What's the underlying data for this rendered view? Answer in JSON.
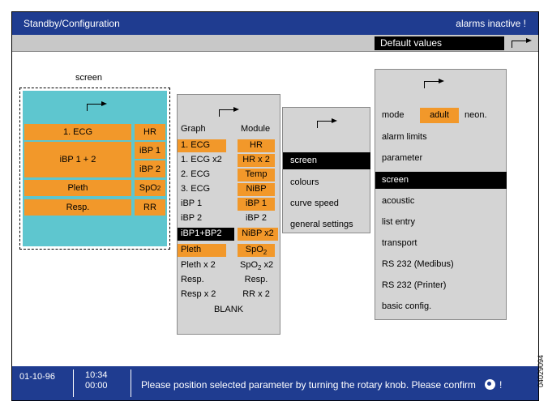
{
  "title": {
    "left": "Standby/Configuration",
    "right": "alarms inactive !"
  },
  "toolbar": {
    "default_values": "Default values",
    "arrow_icon": "return-arrow-icon"
  },
  "preview": {
    "label": "screen",
    "arrow_icon": "return-arrow-icon",
    "cells": {
      "ecg": "1. ECG",
      "hr": "HR",
      "ibp12": "iBP 1 + 2",
      "ibp1": "iBP 1",
      "ibp2": "iBP 2",
      "pleth": "Pleth",
      "spo2": "SpO",
      "spo2_sub": "2",
      "resp": "Resp.",
      "rr": "RR"
    },
    "colors": {
      "background": "#5ec6cf",
      "cell": "#f2982a"
    }
  },
  "module_panel": {
    "headers": {
      "graph": "Graph",
      "module": "Module"
    },
    "graph": [
      "1. ECG",
      "1. ECG x2",
      "2. ECG",
      "3. ECG",
      "iBP 1",
      "iBP 2",
      "iBP1+BP2",
      "Pleth",
      "Pleth x 2",
      "Resp.",
      "Resp x 2"
    ],
    "module": [
      "HR",
      "HR x 2",
      "Temp",
      "NiBP",
      "iBP 1",
      "iBP 2",
      "NiBP x2",
      "SpO",
      "SpO",
      "Resp.",
      "RR x 2"
    ],
    "module_sub": {
      "spo2": "2",
      "spo2x2": "2",
      "spo2x2_suffix": " x2"
    },
    "blank": "BLANK"
  },
  "mid_panel": {
    "items": [
      "screen",
      "colours",
      "curve speed",
      "general settings"
    ]
  },
  "right_panel": {
    "mode_label": "mode",
    "mode_adult": "adult",
    "mode_neon": "neon.",
    "items": [
      "alarm limits",
      "parameter",
      "screen",
      "acoustic",
      "list entry",
      "transport",
      "RS 232 (Medibus)",
      "RS 232 (Printer)",
      "basic config."
    ]
  },
  "status": {
    "date": "01-10-96",
    "time_top": "10:34",
    "time_bottom": "00:00",
    "message": "Please position selected parameter by turning the rotary knob. Please confirm",
    "knob_icon": "rotary-knob-icon",
    "exclaim": "!"
  },
  "side_id": "04029094",
  "colors": {
    "bar": "#1f3c90",
    "accent": "#f2982a",
    "panel": "#d4d4d4"
  }
}
